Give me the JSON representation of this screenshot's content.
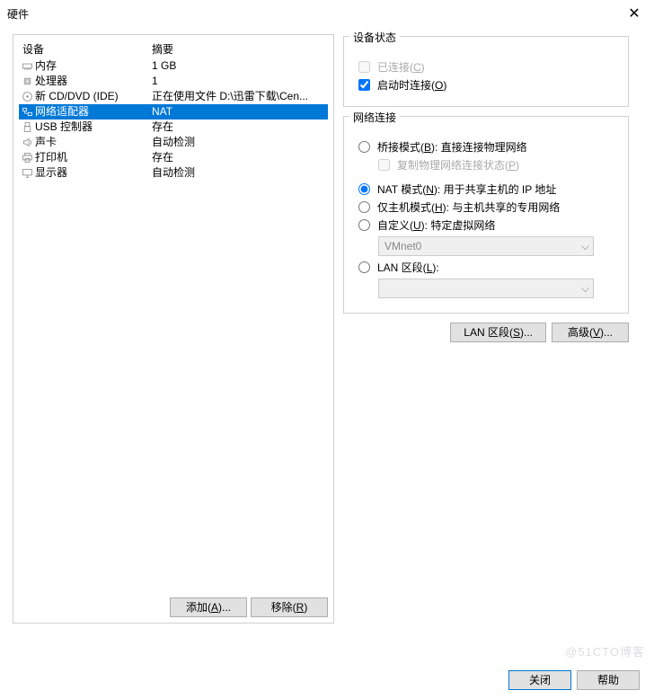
{
  "title": "硬件",
  "columns": {
    "device": "设备",
    "summary": "摘要"
  },
  "devices": [
    {
      "icon": "memory",
      "name": "内存",
      "summary": "1 GB"
    },
    {
      "icon": "cpu",
      "name": "处理器",
      "summary": "1"
    },
    {
      "icon": "disc",
      "name": "新 CD/DVD (IDE)",
      "summary": "正在使用文件 D:\\迅雷下载\\Cen..."
    },
    {
      "icon": "net",
      "name": "网络适配器",
      "summary": "NAT",
      "selected": true
    },
    {
      "icon": "usb",
      "name": "USB 控制器",
      "summary": "存在"
    },
    {
      "icon": "sound",
      "name": "声卡",
      "summary": "自动检测"
    },
    {
      "icon": "printer",
      "name": "打印机",
      "summary": "存在"
    },
    {
      "icon": "display",
      "name": "显示器",
      "summary": "自动检测"
    }
  ],
  "left_footer": {
    "add": "添加(A)...",
    "remove": "移除(R)"
  },
  "device_status": {
    "title": "设备状态",
    "connected": "已连接(C)",
    "connect_on_start": "启动时连接(O)"
  },
  "network": {
    "title": "网络连接",
    "bridged": "桥接模式(B): 直接连接物理网络",
    "replicate": "复制物理网络连接状态(P)",
    "nat": "NAT 模式(N): 用于共享主机的 IP 地址",
    "host_only": "仅主机模式(H): 与主机共享的专用网络",
    "custom": "自定义(U): 特定虚拟网络",
    "custom_value": "VMnet0",
    "lan_segment": "LAN 区段(L):",
    "lan_value": ""
  },
  "right_footer": {
    "lan_segments": "LAN 区段(S)...",
    "advanced": "高级(V)..."
  },
  "bottom": {
    "close": "关闭",
    "help": "帮助"
  },
  "watermark": "@51CTO博客"
}
